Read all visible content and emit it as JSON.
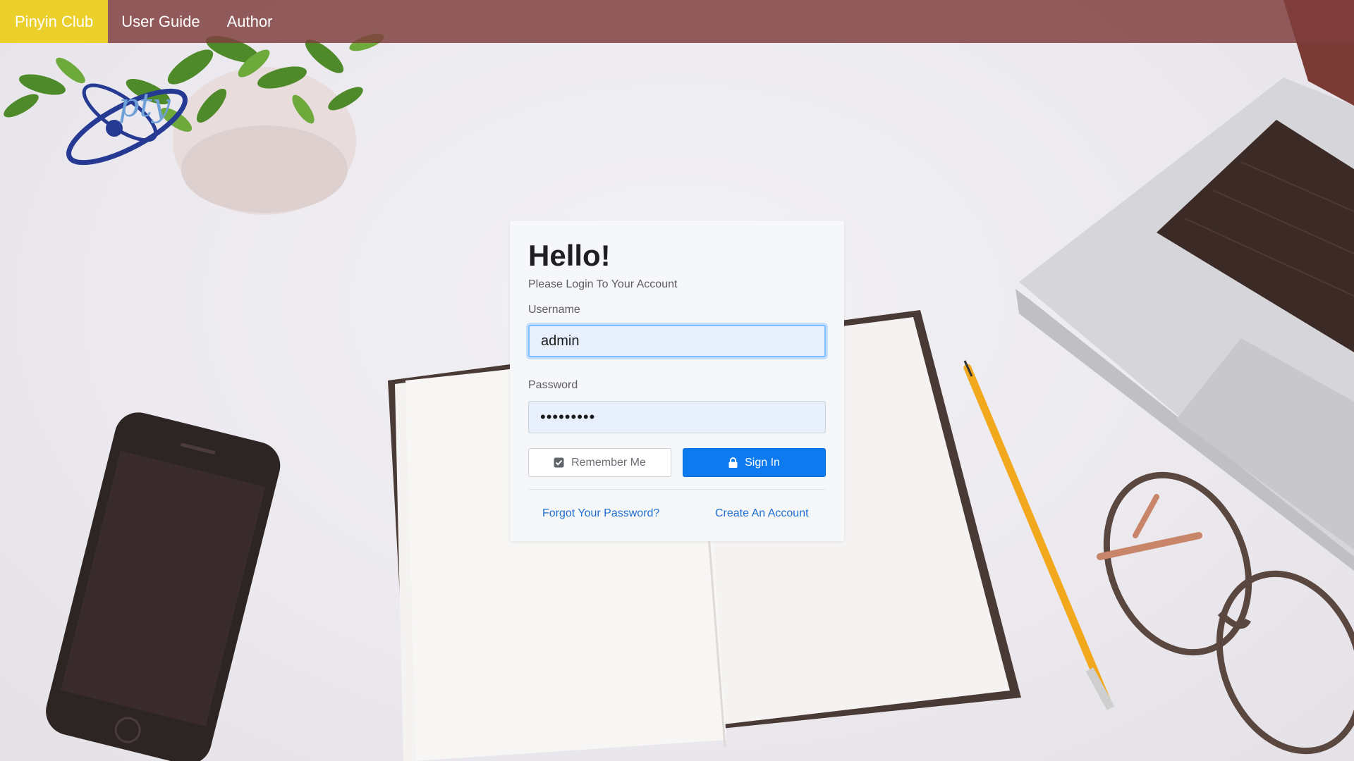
{
  "navbar": {
    "brand": "Pinyin Club",
    "links": [
      "User Guide",
      "Author"
    ]
  },
  "logo": {
    "text": "pty",
    "icon": "orbit-logo-icon"
  },
  "login": {
    "title": "Hello!",
    "subtitle": "Please Login To Your Account",
    "username": {
      "label": "Username",
      "value": "admin"
    },
    "password": {
      "label": "Password",
      "value": "•••••••••"
    },
    "remember_label": "Remember Me",
    "remember_checked": true,
    "signin_label": "Sign In",
    "forgot_link": "Forgot Your Password?",
    "create_link": "Create An Account"
  },
  "icons": {
    "remember": "checkbox-checked-icon",
    "signin": "lock-icon"
  },
  "colors": {
    "navbar": "#803e3e",
    "brand_active": "#ebcf2a",
    "primary": "#0d7af0",
    "link": "#1f6fd1",
    "input_bg": "#e8f0fe",
    "focus_ring": "#80bdff"
  }
}
